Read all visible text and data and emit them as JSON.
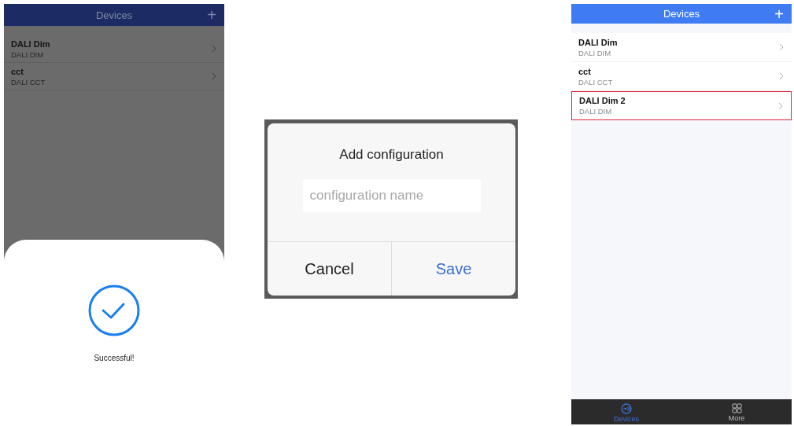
{
  "screens": [
    {
      "kind": "success",
      "header": {
        "title": "Devices",
        "add": "+"
      },
      "devices": [
        {
          "name": "DALI Dim",
          "type": "DALI DIM",
          "highlighted": false
        },
        {
          "name": "cct",
          "type": "DALI CCT",
          "highlighted": false
        }
      ],
      "sheet": {
        "message": "Successful!"
      }
    },
    {
      "kind": "dialog",
      "dialog": {
        "title": "Add configuration",
        "placeholder": "configuration name",
        "buttons": [
          {
            "label": "Cancel",
            "primary": false
          },
          {
            "label": "Save",
            "primary": true
          }
        ]
      }
    },
    {
      "kind": "list",
      "header": {
        "title": "Devices",
        "add": "+"
      },
      "devices": [
        {
          "name": "DALI Dim",
          "type": "DALI DIM",
          "highlighted": false
        },
        {
          "name": "cct",
          "type": "DALI CCT",
          "highlighted": false
        },
        {
          "name": "DALI Dim 2",
          "type": "DALI DIM",
          "highlighted": true
        }
      ],
      "tabs": [
        {
          "label": "Devices",
          "kind": "signal",
          "selected": true
        },
        {
          "label": "More",
          "kind": "grid",
          "selected": false
        }
      ]
    }
  ]
}
